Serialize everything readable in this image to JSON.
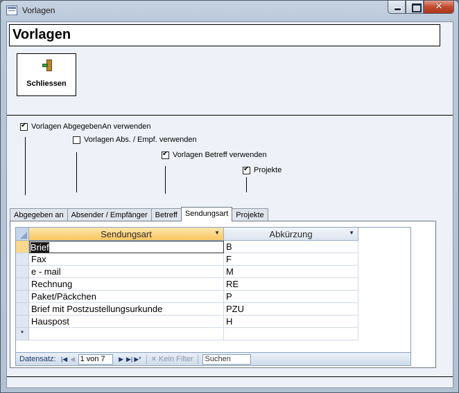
{
  "window": {
    "title": "Vorlagen"
  },
  "form": {
    "title": "Vorlagen",
    "close_label": "Schliessen"
  },
  "options": [
    {
      "label": "Vorlagen AbgegebenAn verwenden",
      "checked": true
    },
    {
      "label": "Vorlagen Abs. / Empf. verwenden",
      "checked": false
    },
    {
      "label": "Vorlagen Betreff verwenden",
      "checked": true
    },
    {
      "label": "Projekte",
      "checked": true
    }
  ],
  "tabs": [
    {
      "label": "Abgegeben an",
      "active": false
    },
    {
      "label": "Absender / Empfänger",
      "active": false
    },
    {
      "label": "Betreff",
      "active": false
    },
    {
      "label": "Sendungsart",
      "active": true
    },
    {
      "label": "Projekte",
      "active": false
    }
  ],
  "table": {
    "columns": [
      "Sendungsart",
      "Abkürzung"
    ],
    "rows": [
      [
        "Brief",
        "B"
      ],
      [
        "Fax",
        "F"
      ],
      [
        "e - mail",
        "M"
      ],
      [
        "Rechnung",
        "RE"
      ],
      [
        "Paket/Päckchen",
        "P"
      ],
      [
        "Brief mit Postzustellungsurkunde",
        "PZU"
      ],
      [
        "Hauspost",
        "H"
      ]
    ],
    "new_row_marker": "*"
  },
  "nav": {
    "label": "Datensatz:",
    "position": "1 von 7",
    "filter_label": "Kein Filter",
    "search_placeholder": "Suchen"
  }
}
